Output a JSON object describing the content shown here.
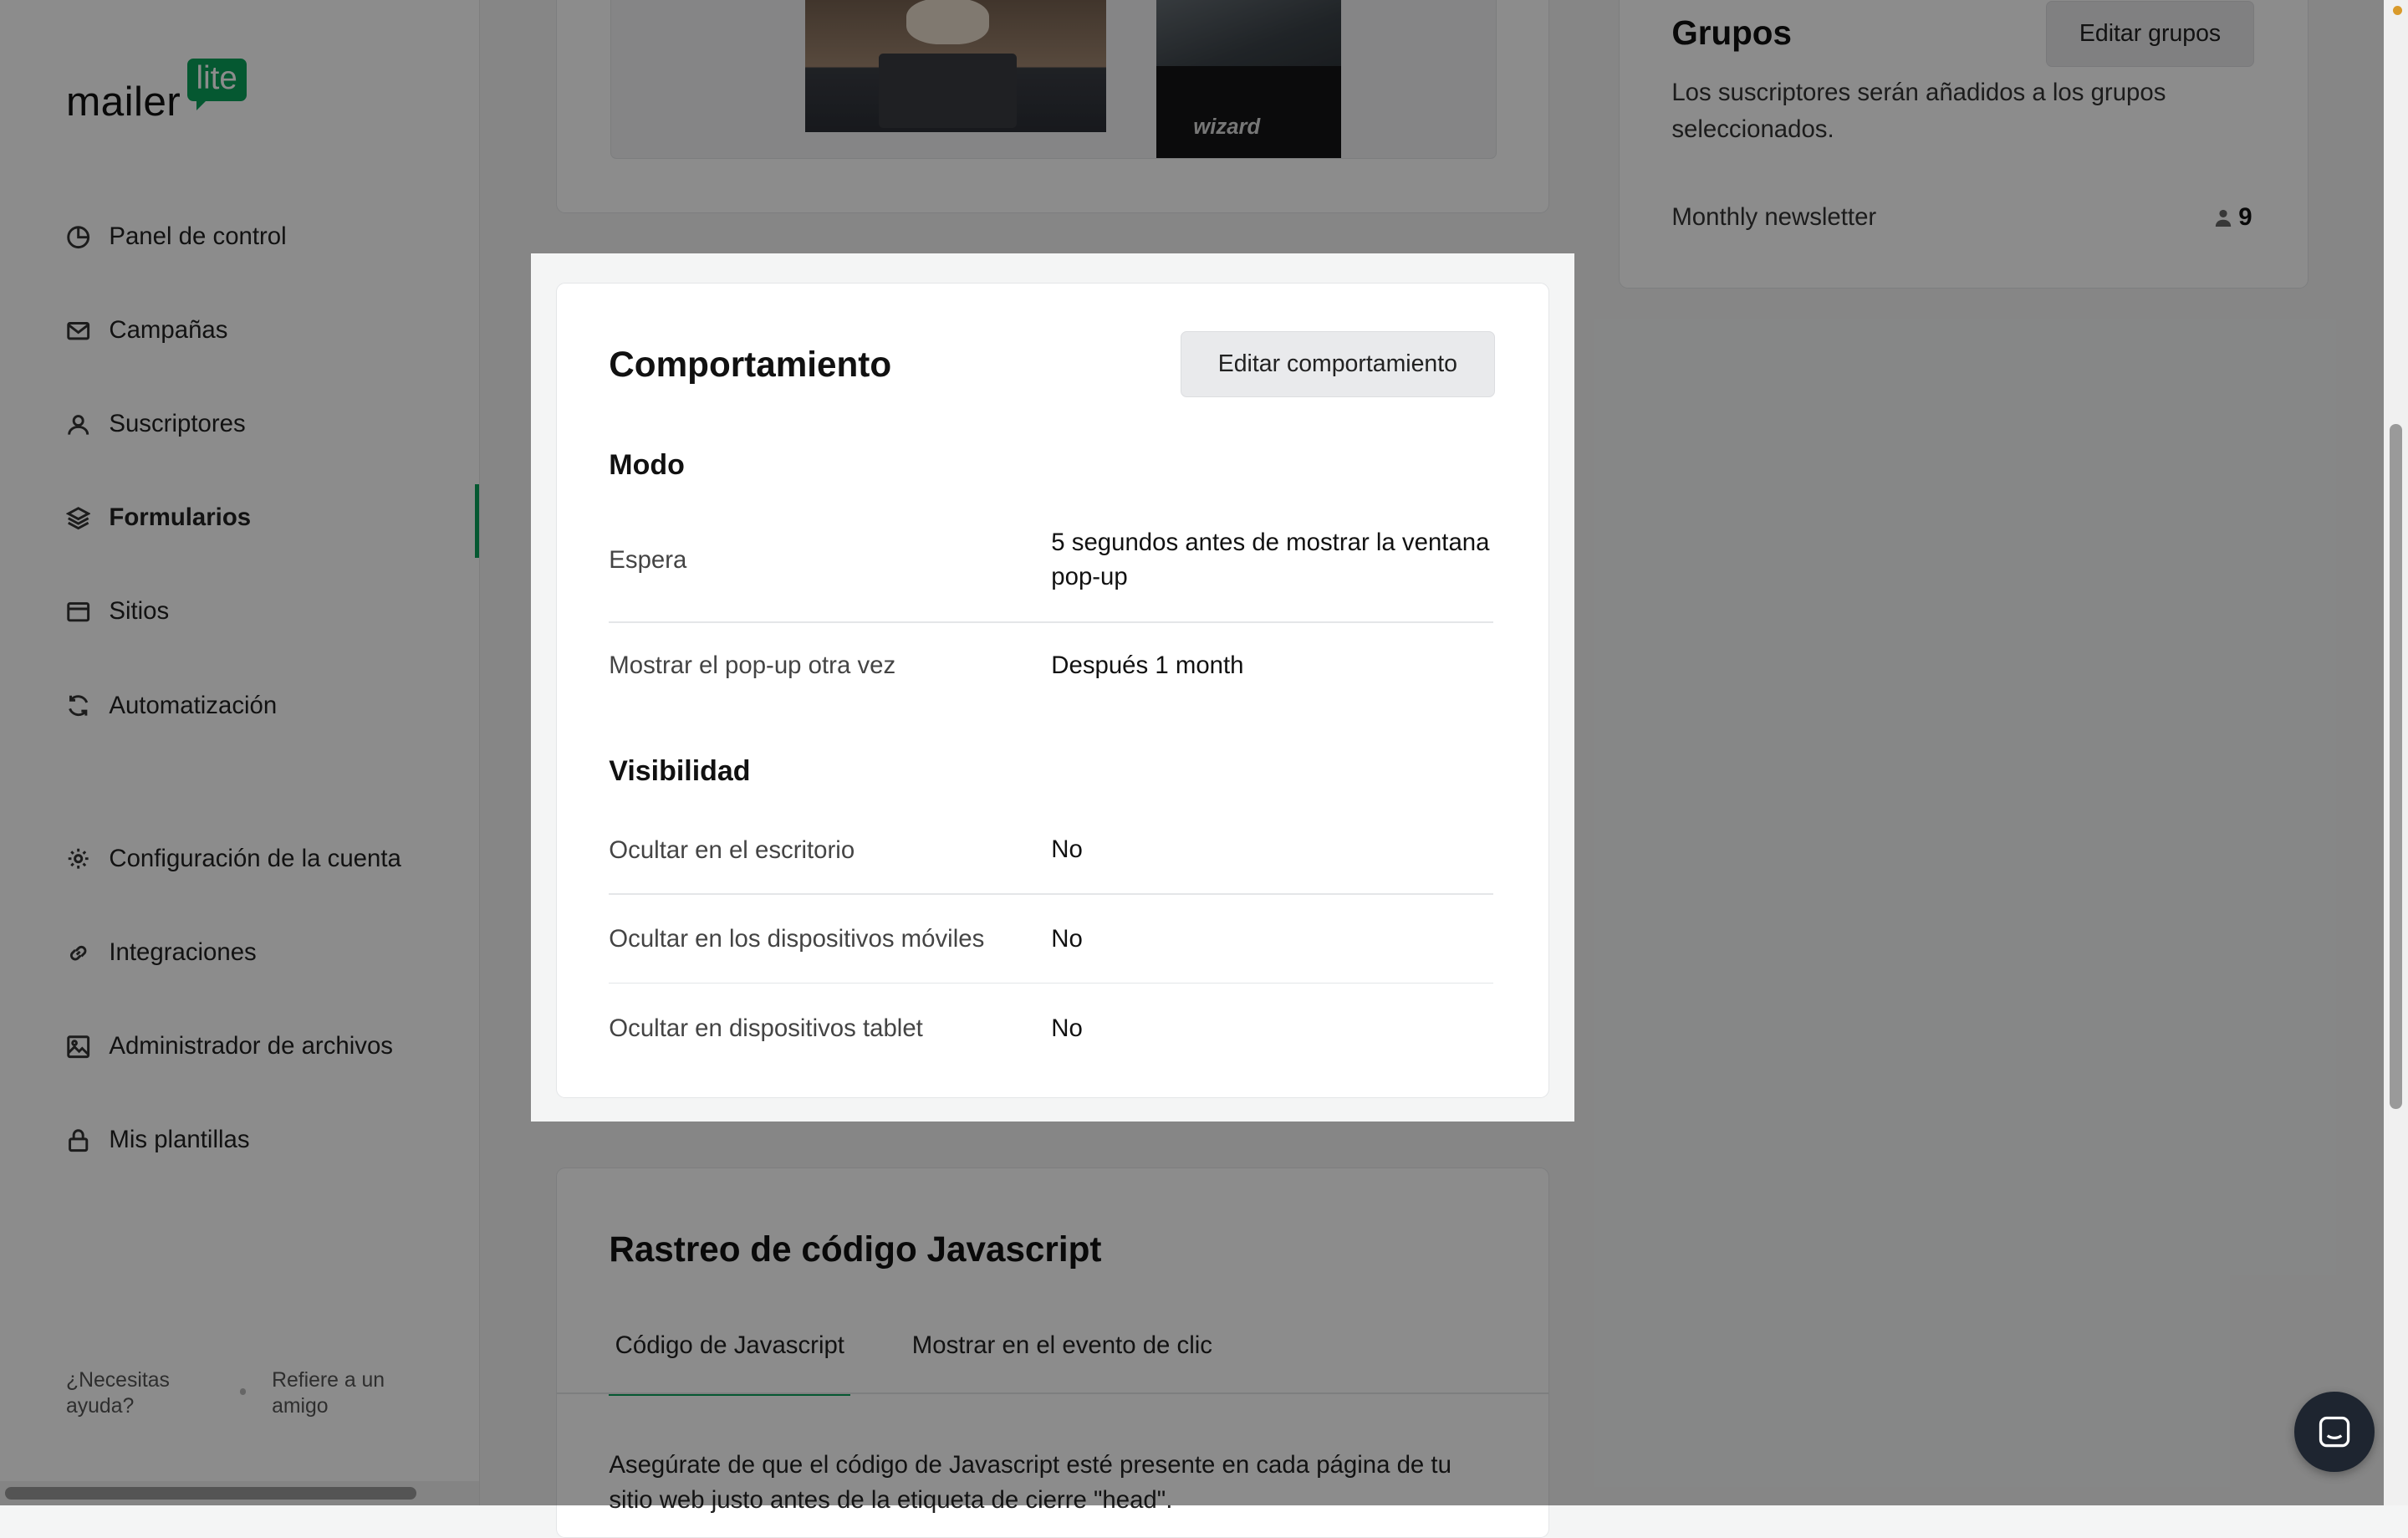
{
  "brand": {
    "name": "mailer",
    "badge": "lite"
  },
  "sidebar": {
    "items": [
      {
        "label": "Panel de control",
        "icon": "clock-pie-icon"
      },
      {
        "label": "Campañas",
        "icon": "mail-icon"
      },
      {
        "label": "Suscriptores",
        "icon": "user-icon"
      },
      {
        "label": "Formularios",
        "icon": "layers-icon",
        "active": true
      },
      {
        "label": "Sitios",
        "icon": "browser-icon"
      },
      {
        "label": "Automatización",
        "icon": "refresh-icon"
      },
      {
        "label": "Configuración de la cuenta",
        "icon": "gear-icon"
      },
      {
        "label": "Integraciones",
        "icon": "link-icon"
      },
      {
        "label": "Administrador de archivos",
        "icon": "image-icon"
      },
      {
        "label": "Mis plantillas",
        "icon": "lock-icon"
      }
    ],
    "footer": {
      "help": "¿Necesitas ayuda?",
      "refer": "Refiere a un amigo"
    }
  },
  "groups_card": {
    "title": "Grupos",
    "edit_button": "Editar grupos",
    "description": "Los suscriptores serán añadidos a los grupos seleccionados.",
    "groups": [
      {
        "name": "Monthly newsletter",
        "count": "9"
      }
    ]
  },
  "preview_card": {
    "image_text": "wizard"
  },
  "behavior_card": {
    "title": "Comportamiento",
    "edit_button": "Editar comportamiento",
    "mode_title": "Modo",
    "mode_rows": [
      {
        "key": "Espera",
        "value": "5 segundos antes de mostrar la ventana pop-up"
      },
      {
        "key": "Mostrar el pop-up otra vez",
        "value": "Después 1 month"
      }
    ],
    "visibility_title": "Visibilidad",
    "visibility_rows": [
      {
        "key": "Ocultar en el escritorio",
        "value": "No"
      },
      {
        "key": "Ocultar en los dispositivos móviles",
        "value": "No"
      },
      {
        "key": "Ocultar en dispositivos tablet",
        "value": "No"
      }
    ]
  },
  "js_card": {
    "title": "Rastreo de código Javascript",
    "tabs": [
      "Código de Javascript",
      "Mostrar en el evento de clic"
    ],
    "body": "Asegúrate de que el código de Javascript esté presente en cada página de tu sitio web justo antes de la etiqueta de cierre \"head\"."
  },
  "colors": {
    "accent": "#0aa05a",
    "overlay": "rgba(0,0,0,0.45)"
  }
}
